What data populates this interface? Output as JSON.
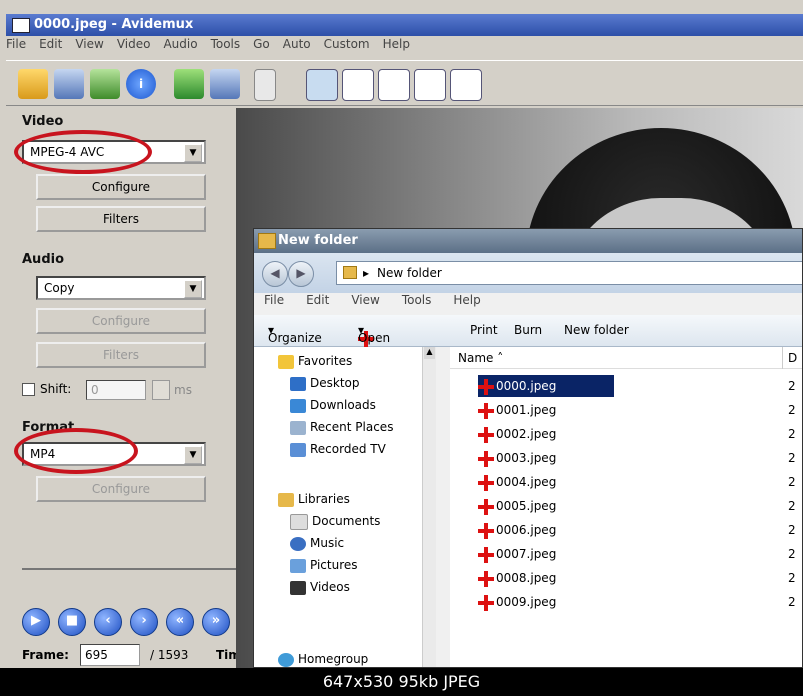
{
  "window": {
    "title": "0000.jpeg - Avidemux"
  },
  "menu": [
    "File",
    "Edit",
    "View",
    "Video",
    "Audio",
    "Tools",
    "Go",
    "Auto",
    "Custom",
    "Help"
  ],
  "toolbar_icons": [
    "open-icon",
    "save-icon",
    "open-alt-icon",
    "info-icon",
    "calculator-icon",
    "save-alt-icon",
    "blank-icon",
    "view-mode-1-icon",
    "view-mode-2-icon",
    "view-mode-3-icon",
    "view-mode-4-icon",
    "view-mode-5-icon"
  ],
  "video": {
    "label": "Video",
    "codec": "MPEG-4 AVC",
    "configure": "Configure",
    "filters": "Filters"
  },
  "audio": {
    "label": "Audio",
    "codec": "Copy",
    "configure": "Configure",
    "filters": "Filters",
    "shift_label": "Shift:",
    "shift_value": "0",
    "shift_unit": "ms"
  },
  "format": {
    "label": "Format",
    "container": "MP4",
    "configure": "Configure"
  },
  "playback": {
    "frame_label": "Frame:",
    "frame_value": "695",
    "frame_total": "/ 1593",
    "time_label": "Tim"
  },
  "explorer": {
    "title": "New folder",
    "address": "New folder",
    "menu": [
      "File",
      "Edit",
      "View",
      "Tools",
      "Help"
    ],
    "commands": {
      "organize": "Organize",
      "open": "Open",
      "print": "Print",
      "burn": "Burn",
      "new_folder": "New folder"
    },
    "nav": {
      "favorites": "Favorites",
      "desktop": "Desktop",
      "downloads": "Downloads",
      "recent": "Recent Places",
      "recorded": "Recorded TV",
      "libraries": "Libraries",
      "documents": "Documents",
      "music": "Music",
      "pictures": "Pictures",
      "videos": "Videos",
      "homegroup": "Homegroup"
    },
    "column_name": "Name",
    "column_date": "D",
    "files": [
      "0000.jpeg",
      "0001.jpeg",
      "0002.jpeg",
      "0003.jpeg",
      "0004.jpeg",
      "0005.jpeg",
      "0006.jpeg",
      "0007.jpeg",
      "0008.jpeg",
      "0009.jpeg"
    ],
    "date_prefix": "2"
  },
  "caption": "647x530 95kb JPEG",
  "colors": {
    "highlight": "#0a2466",
    "annotation": "#c8141e"
  }
}
